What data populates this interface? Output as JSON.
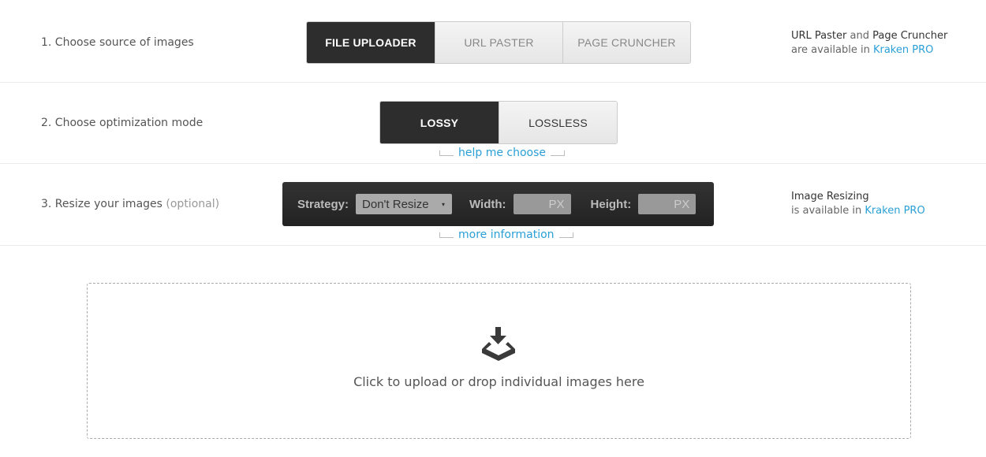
{
  "step1": {
    "label": "1. Choose source of images",
    "options": [
      "FILE UPLOADER",
      "URL PASTER",
      "PAGE CRUNCHER"
    ],
    "selected": "FILE UPLOADER",
    "note": {
      "part1": "URL Paster",
      "and": " and ",
      "part2": "Page Cruncher",
      "line2": "are available in ",
      "link": "Kraken PRO"
    }
  },
  "step2": {
    "label": "2. Choose optimization mode",
    "options": [
      "LOSSY",
      "LOSSLESS"
    ],
    "selected": "LOSSY",
    "hint": "help me choose"
  },
  "step3": {
    "label": "3. Resize your images",
    "optional": "(optional)",
    "strategy_label": "Strategy:",
    "strategy_value": "Don't Resize",
    "caret": "▾",
    "width_label": "Width:",
    "height_label": "Height:",
    "unit": "PX",
    "hint": "more information",
    "note": {
      "line1": "Image Resizing",
      "line2": "is available in ",
      "link": "Kraken PRO"
    }
  },
  "dropzone": {
    "text": "Click to upload or drop individual images here",
    "icon": "download-tray-icon"
  },
  "colors": {
    "accent": "#2a9fd6",
    "dark": "#2d2d2d"
  }
}
